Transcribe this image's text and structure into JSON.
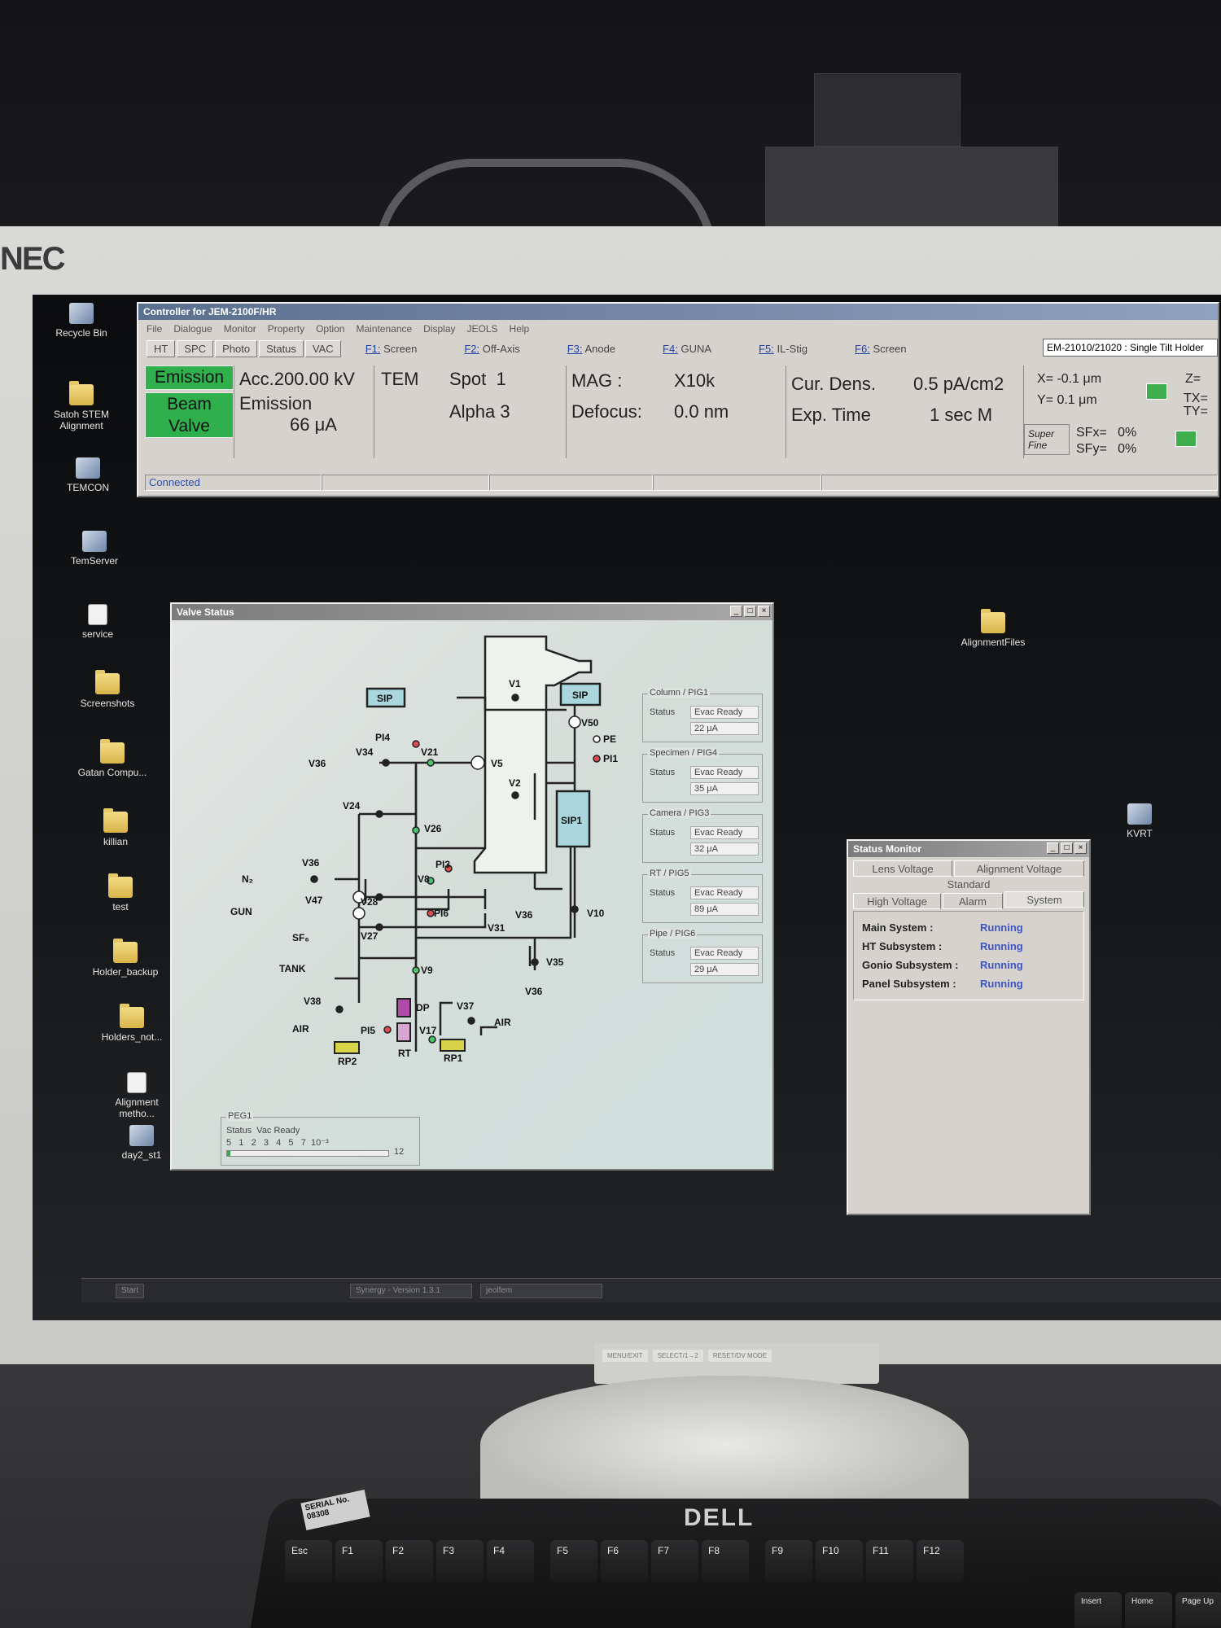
{
  "monitor": {
    "brand": "NEC"
  },
  "desktop_icons": [
    {
      "label": "Recycle Bin",
      "kind": "app"
    },
    {
      "label": "Satoh STEM Alignment",
      "kind": "folder"
    },
    {
      "label": "TEMCON",
      "kind": "app"
    },
    {
      "label": "TemServer",
      "kind": "app"
    },
    {
      "label": "service",
      "kind": "doc"
    },
    {
      "label": "Screenshots",
      "kind": "folder"
    },
    {
      "label": "Gatan Compu...",
      "kind": "folder"
    },
    {
      "label": "killian",
      "kind": "folder"
    },
    {
      "label": "test",
      "kind": "folder"
    },
    {
      "label": "Holder_backup",
      "kind": "folder"
    },
    {
      "label": "Holders_not...",
      "kind": "folder"
    },
    {
      "label": "Alignment metho...",
      "kind": "doc"
    },
    {
      "label": "day2_st1",
      "kind": "app"
    },
    {
      "label": "AlignmentFiles",
      "kind": "folder"
    },
    {
      "label": "KVRT",
      "kind": "app"
    }
  ],
  "controller": {
    "title": "Controller for JEM-2100F/HR",
    "menu": [
      "File",
      "Dialogue",
      "Monitor",
      "Property",
      "Option",
      "Maintenance",
      "Display",
      "JEOLS",
      "Help"
    ],
    "toolbar": [
      "HT",
      "SPC",
      "Photo",
      "Status",
      "VAC"
    ],
    "fkeys": [
      {
        "key": "F1:",
        "label": "Screen"
      },
      {
        "key": "F2:",
        "label": "Off-Axis"
      },
      {
        "key": "F3:",
        "label": "Anode"
      },
      {
        "key": "F4:",
        "label": "GUNA"
      },
      {
        "key": "F5:",
        "label": "IL-Stig"
      },
      {
        "key": "F6:",
        "label": "Screen"
      }
    ],
    "holder": "EM-21010/21020 : Single Tilt Holder",
    "emission_btn": "Emission",
    "beam_valve_1": "Beam",
    "beam_valve_2": "Valve",
    "acc": "Acc.200.00 kV",
    "emission_label": "Emission",
    "emission_value": "66 μA",
    "mode": "TEM",
    "spot": "Spot  1",
    "alpha": "Alpha 3",
    "mag_label": "MAG :",
    "mag_value": "X10k",
    "defocus_label": "Defocus:",
    "defocus_value": "0.0 nm",
    "curdens_label": "Cur. Dens.",
    "curdens_value": "0.5  pA/cm2",
    "exptime_label": "Exp. Time",
    "exptime_value": "1 sec M",
    "x": "X=  -0.1 μm",
    "y": "Y=  0.1 μm",
    "z": "Z=",
    "tx": "TX=",
    "ty": "TY=",
    "super": "Super",
    "fine": "Fine",
    "sfx": "SFx=   0%",
    "sfy": "SFy=   0%",
    "status": "Connected"
  },
  "valve_status": {
    "title": "Valve Status",
    "labels": {
      "sip_left": "SIP",
      "sip_right": "SIP",
      "sip1": "SIP1",
      "v1": "V1",
      "v2": "V2",
      "v5": "V5",
      "v50": "V50",
      "pe": "PE",
      "pi1": "PI1",
      "pi4": "PI4",
      "v34": "V34",
      "v21": "V21",
      "v36a": "V36",
      "v24": "V24",
      "v26": "V26",
      "v36b": "V36",
      "n2": "N₂",
      "pi3": "PI3",
      "v8": "V8",
      "v47": "V47",
      "v28": "V28",
      "gun": "GUN",
      "sf6": "SF₆",
      "v27": "V27",
      "pi6": "PI6",
      "v31": "V31",
      "v36c": "V36",
      "v10": "V10",
      "v35": "V35",
      "tank": "TANK",
      "v9": "V9",
      "dp": "DP",
      "v36d": "V36",
      "v38": "V38",
      "v37": "V37",
      "air1": "AIR",
      "air2": "AIR",
      "pi5": "PI5",
      "v17": "V17",
      "rp2": "RP2",
      "rt": "RT",
      "rp1": "RP1"
    },
    "pigs": [
      {
        "title": "Column / PIG1",
        "status_label": "Status",
        "status": "Evac Ready",
        "current": "22 μA"
      },
      {
        "title": "Specimen / PIG4",
        "status_label": "Status",
        "status": "Evac Ready",
        "current": "35 μA"
      },
      {
        "title": "Camera / PIG3",
        "status_label": "Status",
        "status": "Evac Ready",
        "current": "32 μA"
      },
      {
        "title": "RT / PIG5",
        "status_label": "Status",
        "status": "Evac Ready",
        "current": "89 μA"
      },
      {
        "title": "Pipe / PIG6",
        "status_label": "Status",
        "status": "Evac Ready",
        "current": "29 μA"
      }
    ],
    "peg": {
      "title": "PEG1",
      "status": "Status  Vac Ready",
      "scale": "5   1   2   3   4   5   7  10⁻³",
      "end": "12"
    }
  },
  "status_monitor": {
    "title": "Status Monitor",
    "tabs_row1": [
      "Lens Voltage",
      "Alignment Voltage"
    ],
    "tab_standard": "Standard",
    "tabs_row2": [
      "High Voltage",
      "Alarm",
      "System"
    ],
    "rows": [
      {
        "label": "Main System :",
        "value": "Running"
      },
      {
        "label": "HT Subsystem :",
        "value": "Running"
      },
      {
        "label": "Gonio Subsystem :",
        "value": "Running"
      },
      {
        "label": "Panel Subsystem :",
        "value": "Running"
      }
    ]
  },
  "taskbar": {
    "start": "Start",
    "items": [
      "Synergy - Version 1.3.1",
      "jeolfem"
    ]
  },
  "osd": [
    "MENU/EXIT",
    "SELECT/1→2",
    "RESET/DV MODE"
  ],
  "keyboard": {
    "brand": "DELL",
    "serial": "SERIAL No. 08308",
    "fkeys": [
      "Esc",
      "F1",
      "F2",
      "F3",
      "F4",
      "F5",
      "F6",
      "F7",
      "F8",
      "F9",
      "F10",
      "F11",
      "F12"
    ],
    "bottom": [
      "Insert",
      "Home",
      "Page Up"
    ]
  }
}
